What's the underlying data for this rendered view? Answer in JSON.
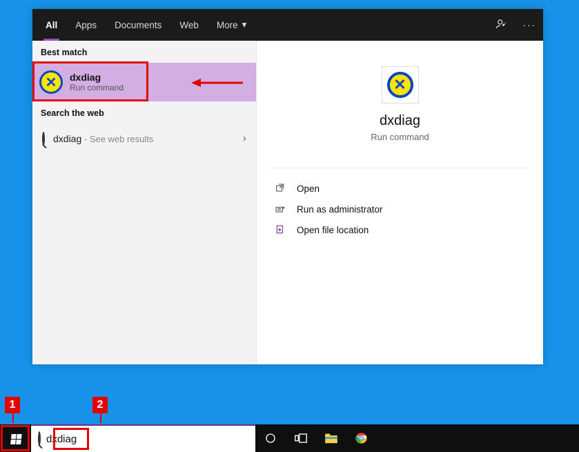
{
  "tabs": {
    "all": "All",
    "apps": "Apps",
    "documents": "Documents",
    "web": "Web",
    "more": "More"
  },
  "sections": {
    "bestMatch": "Best match",
    "searchWeb": "Search the web"
  },
  "bestMatch": {
    "title": "dxdiag",
    "subtitle": "Run command"
  },
  "webResult": {
    "query": "dxdiag",
    "suffix": " - See web results"
  },
  "detail": {
    "title": "dxdiag",
    "subtitle": "Run command"
  },
  "actions": {
    "open": "Open",
    "runAdmin": "Run as administrator",
    "openLocation": "Open file location"
  },
  "searchInput": {
    "value": "dxdiag"
  },
  "callouts": {
    "one": "1",
    "two": "2"
  },
  "dxdiagGlyph": "✕"
}
